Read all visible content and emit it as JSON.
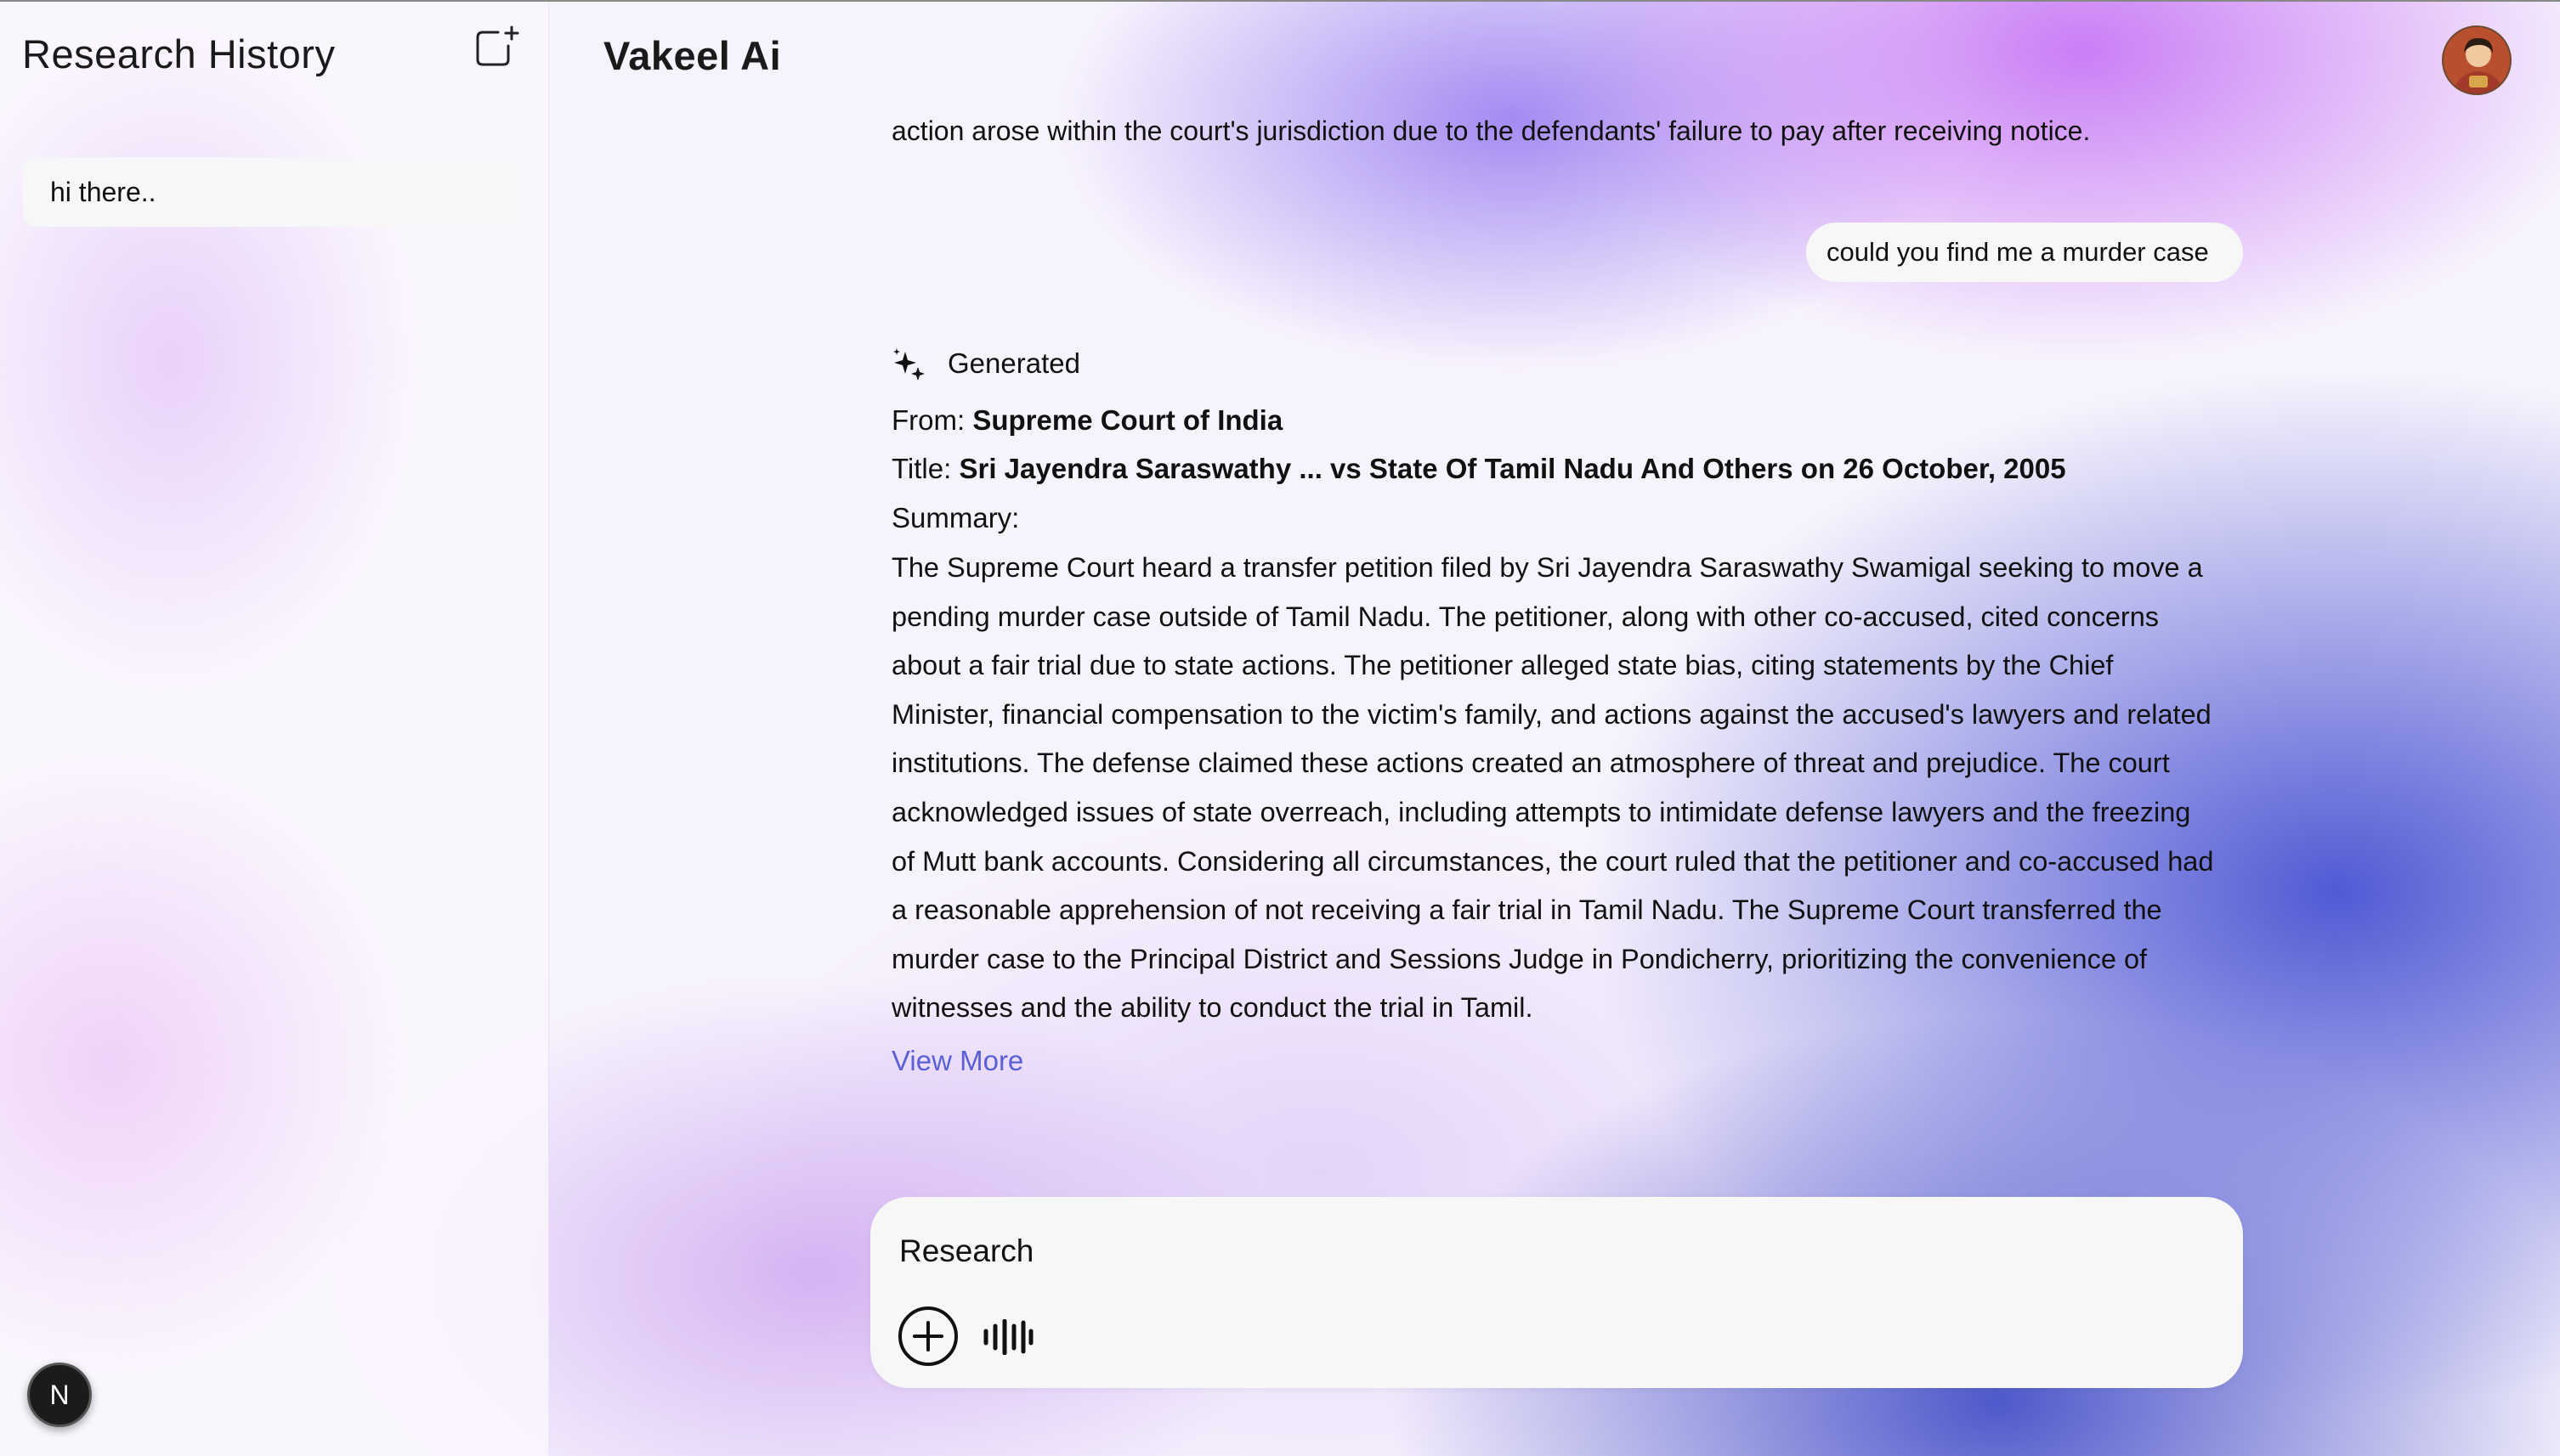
{
  "sidebar": {
    "title": "Research History",
    "new_chat_icon": "new-chat-icon",
    "history": [
      {
        "label": "hi there.."
      }
    ],
    "badge": "N"
  },
  "header": {
    "app_title": "Vakeel Ai",
    "avatar_icon": "user-avatar"
  },
  "chat": {
    "previous_tail": "action arose within the court's jurisdiction due to the defendants' failure to pay after receiving notice.",
    "user_message": "could you find me a murder case",
    "response": {
      "label": "Generated",
      "from_label": "From:",
      "from_value": "Supreme Court of India",
      "title_label": "Title:",
      "title_value": "Sri Jayendra Saraswathy ... vs State Of Tamil Nadu And Others on 26 October, 2005",
      "summary_label": "Summary:",
      "summary": "The Supreme Court heard a transfer petition filed by Sri Jayendra Saraswathy Swamigal seeking to move a pending murder case outside of Tamil Nadu. The petitioner, along with other co-accused, cited concerns about a fair trial due to state actions. The petitioner alleged state bias, citing statements by the Chief Minister, financial compensation to the victim's family, and actions against the accused's lawyers and related institutions. The defense claimed these actions created an atmosphere of threat and prejudice. The court acknowledged issues of state overreach, including attempts to intimidate defense lawyers and the freezing of Mutt bank accounts. Considering all circumstances, the court ruled that the petitioner and co-accused had a reasonable apprehension of not receiving a fair trial in Tamil Nadu. The Supreme Court transferred the murder case to the Principal District and Sessions Judge in Pondicherry, prioritizing the convenience of witnesses and the ability to conduct the trial in Tamil.",
      "view_more": "View More"
    }
  },
  "composer": {
    "placeholder": "Research",
    "value": "",
    "add_icon": "plus-circle-icon",
    "voice_icon": "voice-waveform-icon"
  },
  "colors": {
    "link": "#5b5fd6",
    "accent_purple": "#c878f5",
    "accent_blue": "#4852d2"
  }
}
